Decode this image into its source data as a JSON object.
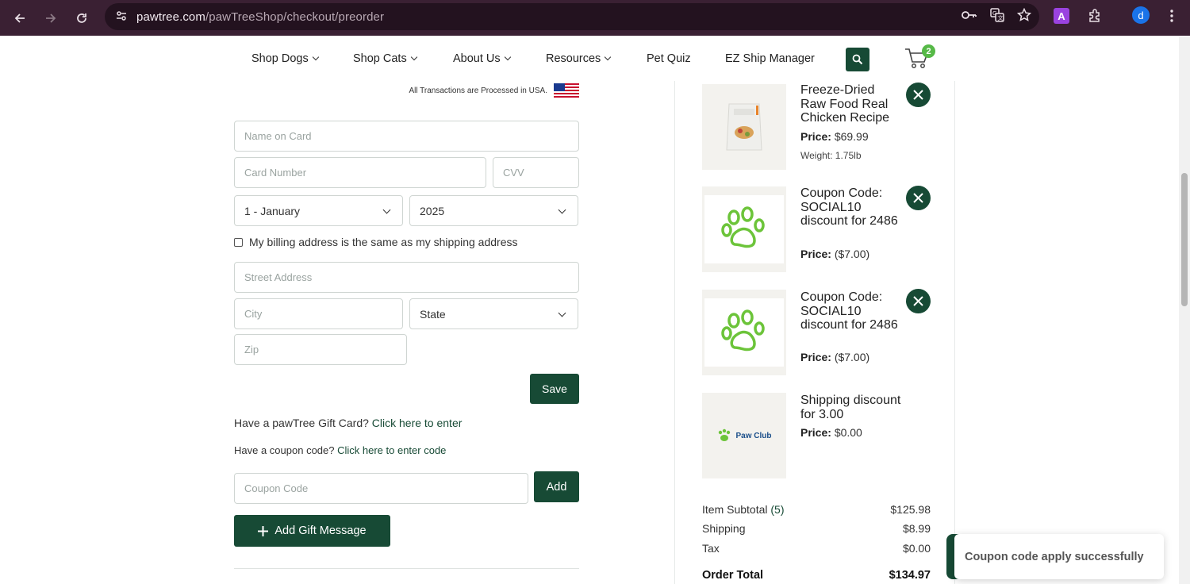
{
  "browser": {
    "url_host": "pawtree.com",
    "url_path": "/pawTreeShop/checkout/preorder",
    "profile_initial": "d",
    "extension_letter": "A",
    "icons": [
      "back-icon",
      "forward-icon",
      "reload-icon",
      "site-info-icon",
      "password-key-icon",
      "translate-icon",
      "star-icon",
      "extensions-icon",
      "menu-icon"
    ]
  },
  "nav": {
    "items": [
      {
        "label": "Shop Dogs",
        "dropdown": true
      },
      {
        "label": "Shop Cats",
        "dropdown": true
      },
      {
        "label": "About Us",
        "dropdown": true
      },
      {
        "label": "Resources",
        "dropdown": true
      },
      {
        "label": "Pet Quiz",
        "dropdown": false
      },
      {
        "label": "EZ Ship Manager",
        "dropdown": false
      }
    ],
    "cart_count": "2"
  },
  "payment": {
    "usa_note": "All Transactions are Processed in USA.",
    "name_placeholder": "Name on Card",
    "card_placeholder": "Card Number",
    "cvv_placeholder": "CVV",
    "month_value": "1 - January",
    "year_value": "2025",
    "billing_same_label": "My billing address is the same as my shipping address",
    "billing_same_checked": false,
    "street_placeholder": "Street Address",
    "city_placeholder": "City",
    "state_value": "State",
    "zip_placeholder": "Zip",
    "save_label": "Save"
  },
  "gift_card": {
    "prompt": "Have a pawTree Gift Card?",
    "link": "Click here to enter"
  },
  "coupon": {
    "prompt": "Have a coupon code?",
    "link": "Click here to enter code",
    "placeholder": "Coupon Code",
    "add_label": "Add"
  },
  "gift_message": {
    "label": "Add Gift Message"
  },
  "cart_items": [
    {
      "title": "Freeze-Dried Raw Food Real Chicken Recipe",
      "price_label": "Price:",
      "price": "$69.99",
      "weight": "Weight: 1.75lb",
      "image": "food-bag",
      "removable": true
    },
    {
      "title": "Coupon Code: SOCIAL10 discount for 2486",
      "price_label": "Price:",
      "price": "($7.00)",
      "image": "paw",
      "removable": true
    },
    {
      "title": "Coupon Code: SOCIAL10 discount for 2486",
      "price_label": "Price:",
      "price": "($7.00)",
      "image": "paw",
      "removable": true
    },
    {
      "title": "Shipping discount for 3.00",
      "price_label": "Price:",
      "price": "$0.00",
      "image": "paw-club",
      "image_text": "Paw Club",
      "removable": false
    }
  ],
  "summary": {
    "subtotal_label": "Item Subtotal",
    "subtotal_count": "(5)",
    "subtotal": "$125.98",
    "shipping_label": "Shipping",
    "shipping": "$8.99",
    "tax_label": "Tax",
    "tax": "$0.00",
    "total_label": "Order Total",
    "total": "$134.97"
  },
  "toast": {
    "message": "Coupon code apply successfully"
  },
  "colors": {
    "brand_green": "#174a35",
    "accent_green": "#56b947",
    "chrome_bg": "#3a2033"
  }
}
